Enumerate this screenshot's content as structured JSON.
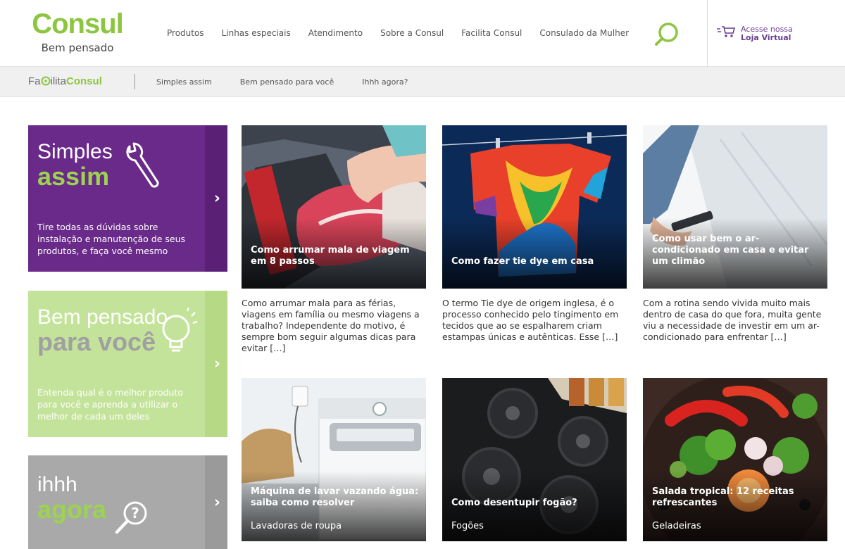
{
  "header": {
    "logo_word": "Consul",
    "logo_tagline": "Bem pensado",
    "nav": [
      "Produtos",
      "Linhas especiais",
      "Atendimento",
      "Sobre a Consul",
      "Facilita Consul",
      "Consulado da Mulher"
    ],
    "store_line1": "Acesse nossa",
    "store_line2": "Loja Virtual"
  },
  "subnav": {
    "brand_part1": "Fa",
    "brand_part2": "ilita",
    "brand_part3": "Consul",
    "links": [
      "Simples assim",
      "Bem pensado para você",
      "Ihhh agora?"
    ]
  },
  "promos": [
    {
      "title1": "Simples",
      "title2": "assim",
      "desc": "Tire todas as dúvidas sobre instalação e manutenção de seus produtos, e faça você mesmo"
    },
    {
      "title1": "Bem pensado",
      "title2": "para você",
      "desc": "Entenda qual é o melhor produto para você e aprenda a utilizar o melhor de cada um deles"
    },
    {
      "title1": "ihhh",
      "title2": "agora"
    }
  ],
  "articles": [
    {
      "title": "Como arrumar mala de viagem em 8 passos",
      "excerpt": "Como arrumar mala para as férias, viagens em família ou mesmo viagens a trabalho? Independente do motivo, é sempre bom seguir algumas dicas para evitar […]"
    },
    {
      "title": "Como fazer tie dye em casa",
      "excerpt": "O termo Tie dye de origem inglesa, é o processo conhecido pelo tingimento em tecidos que ao se espalharem criam estampas únicas e autênticas. Esse […]"
    },
    {
      "title": "Como usar bem o ar-condicionado em casa e evitar um climão",
      "excerpt": "Com a rotina sendo vivida muito mais dentro de casa do que fora, muita gente viu a necessidade de investir em um ar-condicionado para enfrentar […]"
    },
    {
      "title": "Máquina de lavar vazando água: saiba como resolver",
      "category": "Lavadoras de roupa"
    },
    {
      "title": "Como desentupir fogão?",
      "category": "Fogões"
    },
    {
      "title": "Salada tropical: 12 receitas refrescantes",
      "category": "Geladeiras"
    }
  ],
  "colors": {
    "brand_green": "#8cc63f",
    "brand_purple": "#6a2a8a",
    "light_green": "#c4e39a",
    "gray_tile": "#a9a9a9"
  }
}
